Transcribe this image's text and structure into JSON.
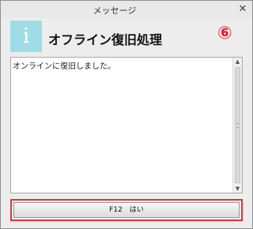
{
  "window": {
    "title": "メッセージ",
    "close_glyph": "✕"
  },
  "header": {
    "icon_glyph": "i",
    "icon_name": "info-icon",
    "heading": "オフライン復旧処理",
    "marker": "⑥"
  },
  "message": {
    "text": "オンラインに復旧しました。"
  },
  "button": {
    "label": "F12　はい"
  },
  "colors": {
    "icon_background": "#9fdde6",
    "marker": "#e8202a",
    "highlight_border": "#e0343a"
  }
}
